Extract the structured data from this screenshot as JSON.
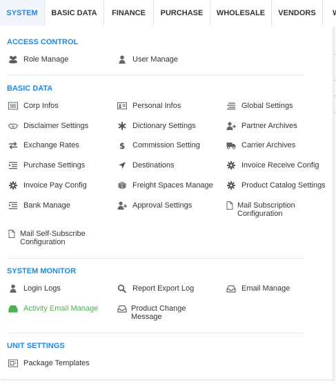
{
  "nav": {
    "tabs": [
      {
        "label": "SYSTEM",
        "active": true
      },
      {
        "label": "BASIC DATA"
      },
      {
        "label": "FINANCE"
      },
      {
        "label": "PURCHASE"
      },
      {
        "label": "WHOLESALE"
      },
      {
        "label": "VENDORS"
      },
      {
        "label": "W"
      }
    ]
  },
  "colors": {
    "accent": "#1e88e5",
    "green": "#4caf50"
  },
  "sections": {
    "access_control": {
      "title": "ACCESS CONTROL",
      "items": [
        {
          "label": "Role Manage",
          "icon": "users-icon"
        },
        {
          "label": "User Manage",
          "icon": "user-icon"
        }
      ]
    },
    "basic_data": {
      "title": "BASIC DATA",
      "items": [
        {
          "label": "Corp Infos",
          "icon": "list-card-icon"
        },
        {
          "label": "Personal Infos",
          "icon": "id-card-icon"
        },
        {
          "label": "Global Settings",
          "icon": "lines-icon"
        },
        {
          "label": "Disclaimer Settings",
          "icon": "handshake-icon"
        },
        {
          "label": "Dictionary Settings",
          "icon": "asterisk-icon"
        },
        {
          "label": "Partner Archives",
          "icon": "user-plus-icon"
        },
        {
          "label": "Exchange Rates",
          "icon": "exchange-icon"
        },
        {
          "label": "Commission Setting",
          "icon": "dollar-icon"
        },
        {
          "label": "Carrier Archives",
          "icon": "truck-icon"
        },
        {
          "label": "Purchase Settings",
          "icon": "indent-icon"
        },
        {
          "label": "Destinations",
          "icon": "location-arrow-icon"
        },
        {
          "label": "Invoice Receive Config",
          "icon": "gear-icon"
        },
        {
          "label": "Invoice Pay Config",
          "icon": "gear-icon"
        },
        {
          "label": "Freight Spaces Manage",
          "icon": "cube-icon"
        },
        {
          "label": "Product Catalog Settings",
          "icon": "gear-icon"
        },
        {
          "label": "Bank Manage",
          "icon": "indent-icon"
        },
        {
          "label": "Approval Settings",
          "icon": "user-plus-icon"
        },
        {
          "label": "Mail Subscription Configuration",
          "icon": "file-icon"
        },
        {
          "label": "Mail Self-Subscribe Configuration",
          "icon": "file-icon"
        }
      ]
    },
    "system_monitor": {
      "title": "SYSTEM MONITOR",
      "items": [
        {
          "label": "Login Logs",
          "icon": "user-icon"
        },
        {
          "label": "Report Export Log",
          "icon": "search-icon"
        },
        {
          "label": "Email Manage",
          "icon": "inbox-icon"
        },
        {
          "label": "Activity Email Manage",
          "icon": "inbox-icon"
        },
        {
          "label": "Product Change Message",
          "icon": "inbox-icon"
        }
      ]
    },
    "unit_settings": {
      "title": "UNIT SETTINGS",
      "items": [
        {
          "label": "Package Templates",
          "icon": "template-icon"
        }
      ]
    }
  }
}
